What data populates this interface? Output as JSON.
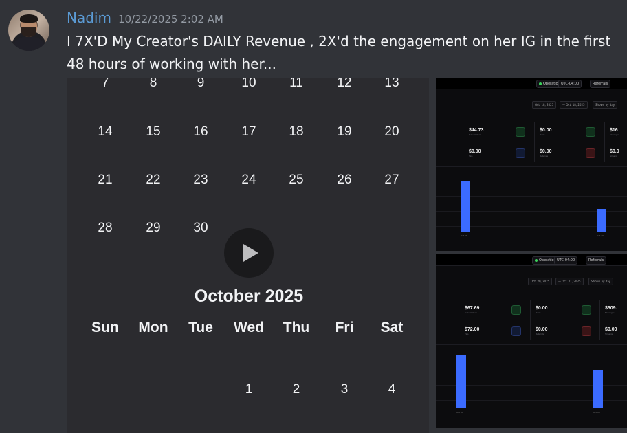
{
  "message": {
    "username": "Nadim",
    "timestamp": "10/22/2025 2:02 AM",
    "text": "I 7X'D My Creator's DAILY Revenue , 2X'd the engagement on her IG in the first 48 hours of working with her..."
  },
  "video": {
    "prev_rows": [
      [
        "7",
        "8",
        "9",
        "10",
        "11",
        "12",
        "13"
      ],
      [
        "14",
        "15",
        "16",
        "17",
        "18",
        "19",
        "20"
      ],
      [
        "21",
        "22",
        "23",
        "24",
        "25",
        "26",
        "27"
      ],
      [
        "28",
        "29",
        "30",
        "",
        "",
        "",
        ""
      ]
    ],
    "month_title": "October 2025",
    "weekdays": [
      "Sun",
      "Mon",
      "Tue",
      "Wed",
      "Thu",
      "Fri",
      "Sat"
    ],
    "first_row": [
      "",
      "",
      "",
      "1",
      "2",
      "3",
      "4"
    ],
    "play_icon": "play-icon"
  },
  "screenshot1": {
    "status": "Operational",
    "timezone": "UTC-04:00",
    "referrals": "Referrals",
    "date_from": "Oct. 18, 2025",
    "date_to": "Oct. 18, 2025",
    "granularity": "Shown by day",
    "stats": [
      {
        "value": "$44.73",
        "label": "Subscriptions"
      },
      {
        "value": "$0.00",
        "label": "Posts"
      },
      {
        "value": "$16",
        "label": "Messages"
      },
      {
        "value": "$0.00",
        "label": "Tips"
      },
      {
        "value": "$0.00",
        "label": "Referrals"
      },
      {
        "value": "$0.0",
        "label": "Streams"
      }
    ],
    "bars": [
      {
        "label": "Oct 18",
        "value": 1.0
      },
      {
        "label": "Oct 19",
        "value": 0.45
      }
    ]
  },
  "screenshot2": {
    "status": "Operational",
    "timezone": "UTC-04:00",
    "referrals": "Referrals",
    "date_from": "Oct. 20, 2025",
    "date_to": "Oct. 21, 2025",
    "granularity": "Shown by day",
    "stats": [
      {
        "value": "$67.69",
        "label": "Subscriptions"
      },
      {
        "value": "$0.00",
        "label": "Posts"
      },
      {
        "value": "$309.",
        "label": "Messages"
      },
      {
        "value": "$72.00",
        "label": "Tips"
      },
      {
        "value": "$0.00",
        "label": "Referrals"
      },
      {
        "value": "$0.00",
        "label": "Streams"
      }
    ],
    "bars": [
      {
        "label": "Oct 20",
        "value": 1.0
      },
      {
        "label": "Oct 21",
        "value": 0.7
      }
    ]
  },
  "colors": {
    "username": "#5b9bd5",
    "background": "#313338",
    "bar": "#3b6bff",
    "status_dot": "#3bd35b"
  }
}
